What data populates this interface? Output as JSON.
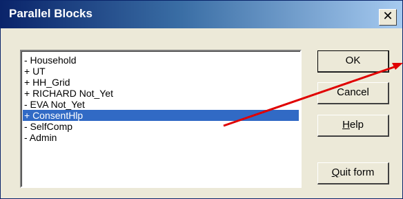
{
  "window": {
    "title": "Parallel Blocks",
    "close_glyph": "✕"
  },
  "list": {
    "items": [
      {
        "label": "- Household",
        "selected": false
      },
      {
        "label": "+ UT",
        "selected": false
      },
      {
        "label": "+ HH_Grid",
        "selected": false
      },
      {
        "label": "+ RICHARD Not_Yet",
        "selected": false
      },
      {
        "label": "- EVA Not_Yet",
        "selected": false
      },
      {
        "label": "+ ConsentHlp",
        "selected": true
      },
      {
        "label": "- SelfComp",
        "selected": false
      },
      {
        "label": "- Admin",
        "selected": false
      }
    ]
  },
  "buttons": {
    "ok": "OK",
    "cancel": "Cancel",
    "help_mnemonic": "H",
    "help_rest": "elp",
    "quit_mnemonic": "Q",
    "quit_rest": "uit form"
  },
  "annotation": {
    "arrow_color": "#e00000"
  }
}
